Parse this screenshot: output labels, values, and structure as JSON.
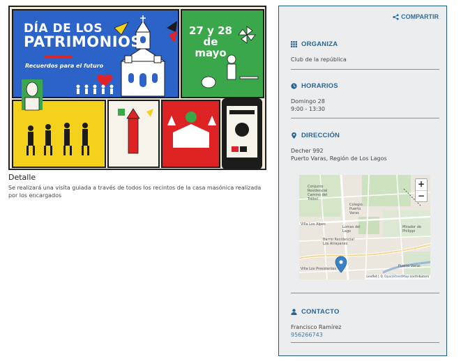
{
  "poster": {
    "title_line1": "DÍA DE LOS",
    "title_line2": "PATRIMONIOS",
    "subtitle": "Recuerdos para el futuro",
    "date": "27 y 28 de mayo",
    "colors": {
      "blue": "#2b63c9",
      "green": "#3aa84a",
      "yellow": "#f4d21c",
      "red": "#dd2323",
      "cream": "#f4ecd9"
    }
  },
  "detail": {
    "heading": "Detalle",
    "description": "Se realizará una visita guiada a través de todos los recintos de la casa masónica realizada por los encargados"
  },
  "sidebar": {
    "share_label": "COMPARTIR",
    "organiza": {
      "title": "ORGANIZA",
      "value": "Club de la república"
    },
    "horarios": {
      "title": "HORARIOS",
      "day": "Domingo 28",
      "time": "9:00 - 13:30"
    },
    "direccion": {
      "title": "DIRECCIÓN",
      "street": "Decher 992",
      "city": "Puerto Varas, Región de Los Lagos"
    },
    "map": {
      "zoom_in": "+",
      "zoom_out": "−",
      "labels": {
        "l1": "Conjunto Residencial Camino del Trébol",
        "l2": "Colegio Puerto Varas",
        "l3": "Villa Los Alpes",
        "l4": "Lomas del Lago",
        "l5": "Barrio Residencial Los Arrayanes",
        "l6": "Mirador de Philippi",
        "l7": "Villa Los Presidentes",
        "l8": "Puerto Varas"
      },
      "attribution_leaflet": "Leaflet",
      "attribution_sep": " | © ",
      "attribution_osm": "OpenStreetMap",
      "attribution_tail": " contributors"
    },
    "contacto": {
      "title": "CONTACTO",
      "name": "Francisco Ramírez",
      "phone": "956266743"
    },
    "accent": "#2a6592"
  }
}
